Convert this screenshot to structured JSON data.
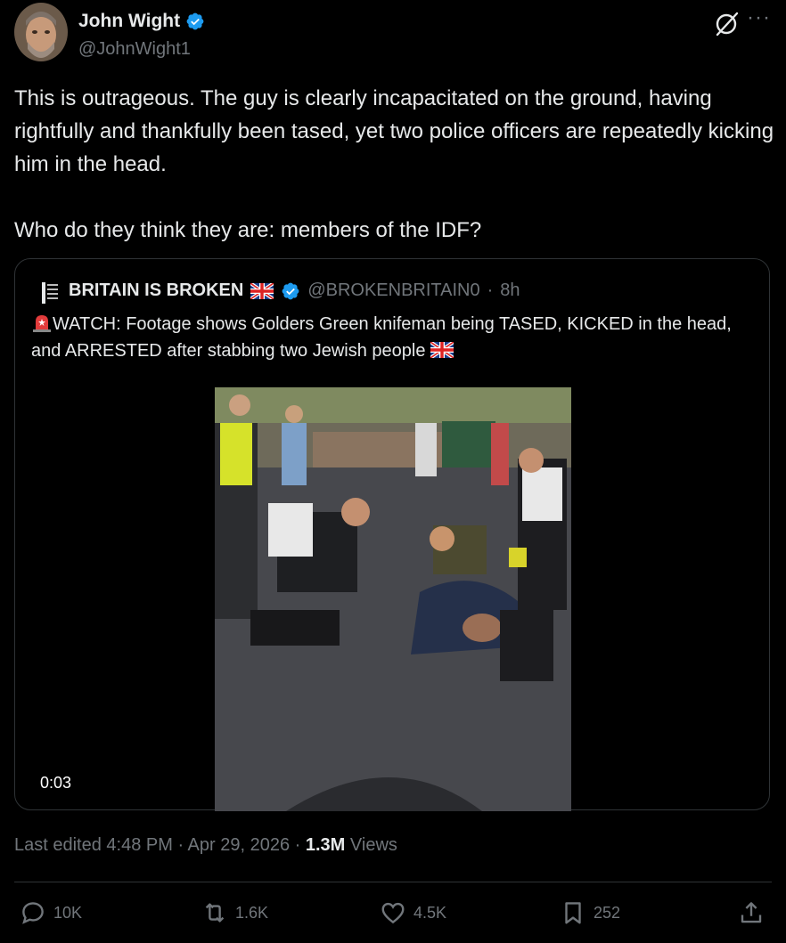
{
  "author": {
    "name": "John Wight",
    "handle": "@JohnWight1"
  },
  "tweet": {
    "text": "This is outrageous. The guy is clearly incapacitated on the ground, having rightfully and thankfully been tased, yet two police officers are repeatedly kicking him in the head.\n\nWho do they think they are: members of the IDF?"
  },
  "quote": {
    "name": "BRITAIN IS BROKEN",
    "handle": "@BROKENBRITAIN0",
    "separator": "·",
    "time": "8h",
    "text": "WATCH: Footage shows Golders Green knifeman being TASED, KICKED in the head, and ARRESTED after stabbing two Jewish people",
    "video_duration": "0:03"
  },
  "meta": {
    "edited": "Last edited 4:48 PM · Apr 29, 2026 ·",
    "views_count": "1.3M",
    "views_label": "Views"
  },
  "actions": {
    "replies": "10K",
    "reposts": "1.6K",
    "likes": "4.5K",
    "bookmarks": "252"
  },
  "colors": {
    "background": "#000000",
    "text": "#e7e9ea",
    "muted": "#71767b",
    "border": "#2f3336",
    "verified": "#1d9bf0"
  }
}
